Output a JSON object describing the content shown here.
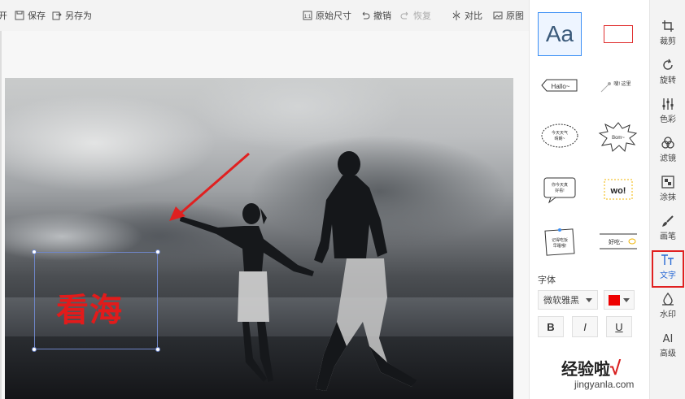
{
  "toolbar": {
    "partial_label": "开",
    "save_label": "保存",
    "save_as_label": "另存为",
    "original_size_label": "原始尺寸",
    "undo_label": "撤销",
    "redo_label": "恢复",
    "compare_label": "对比",
    "original_label": "原图"
  },
  "canvas": {
    "text_overlay": "看海",
    "text_color": "#e21b1b",
    "selection_color": "#6f86c8",
    "arrow_color": "#e02020"
  },
  "text_panel": {
    "aa_label": "Aa",
    "templates": {
      "hallo": "Hallo~",
      "here": "嗖! 这里",
      "cloud_line1": "今天天气",
      "cloud_line2": "晴朗~",
      "bom": "Bom~",
      "card_line1": "你今天真",
      "card_line2": "好看!",
      "wo": "wo!",
      "note_line1": "记得吃饭",
      "note_line2": "早睡哦!",
      "delicious": "好吃~"
    },
    "font_label": "字体",
    "font_value": "微软雅黑",
    "color_value": "#ee0000",
    "bold_label": "B",
    "italic_label": "I",
    "underline_label": "U"
  },
  "rail": {
    "items": [
      {
        "label": "裁剪",
        "icon": "crop-icon"
      },
      {
        "label": "旋转",
        "icon": "rotate-icon"
      },
      {
        "label": "色彩",
        "icon": "sliders-icon"
      },
      {
        "label": "滤镜",
        "icon": "filter-icon"
      },
      {
        "label": "涂抹",
        "icon": "mosaic-icon"
      },
      {
        "label": "画笔",
        "icon": "brush-icon"
      },
      {
        "label": "文字",
        "icon": "text-icon"
      },
      {
        "label": "水印",
        "icon": "watermark-icon"
      },
      {
        "label": "高级",
        "icon": "ai-icon"
      }
    ],
    "active": "文字",
    "active_color": "#e02020"
  },
  "footer": {
    "watermark_text": "经验啦",
    "watermark_check": "√",
    "watermark_url": "jingyanla.com"
  }
}
